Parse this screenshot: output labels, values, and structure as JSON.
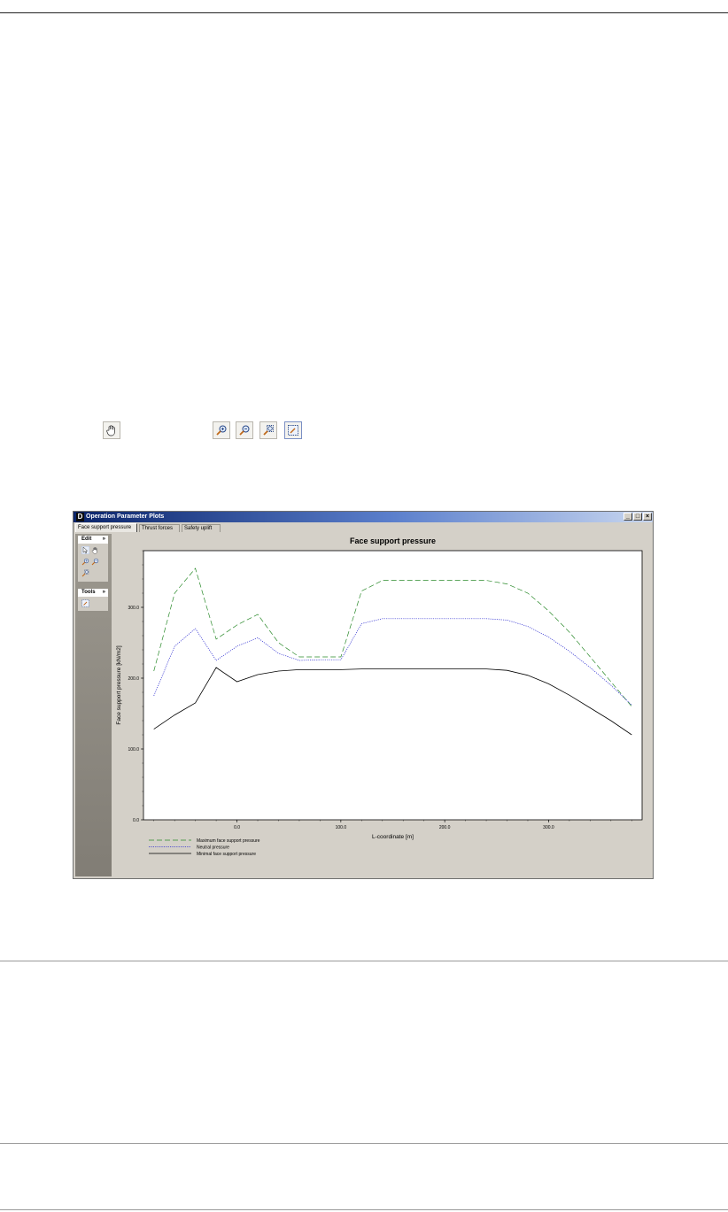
{
  "toolbar": {
    "icons": [
      "pan-hand-icon",
      "zoom-in-icon",
      "zoom-out-icon",
      "zoom-reset-icon",
      "zoom-window-icon"
    ]
  },
  "window": {
    "title": "Operation Parameter Plots",
    "logo": "D",
    "controls": {
      "minimize": "_",
      "maximize": "□",
      "close": "×"
    },
    "tabs": [
      {
        "label": "Face support pressure",
        "active": true
      },
      {
        "label": "Thrust forces",
        "active": false
      },
      {
        "label": "Safety uplift",
        "active": false
      }
    ],
    "sidebar": {
      "edit_label": "Edit",
      "tools_label": "Tools",
      "collapse_glyph": "»"
    }
  },
  "chart_data": {
    "type": "line",
    "title": "Face support pressure",
    "xlabel": "L-coordinate [m]",
    "ylabel": "Face support pressure [kN/m2]",
    "xlim": [
      -90,
      390
    ],
    "ylim": [
      0,
      380
    ],
    "x_ticks": [
      "0.0",
      "100.0",
      "200.0",
      "300.0"
    ],
    "y_ticks": [
      "0.0",
      "100.0",
      "200.0",
      "300.0"
    ],
    "grid": false,
    "legend_position": "bottom-left",
    "series": [
      {
        "name": "Maximum face support pressure",
        "style": "dashed",
        "color": "#2a8a2a",
        "x": [
          -80,
          -60,
          -40,
          -20,
          0,
          20,
          40,
          60,
          80,
          100,
          120,
          140,
          160,
          180,
          200,
          220,
          240,
          260,
          280,
          300,
          320,
          340,
          360,
          380
        ],
        "y": [
          210,
          320,
          355,
          255,
          275,
          290,
          250,
          230,
          230,
          230,
          323,
          338,
          338,
          338,
          338,
          338,
          338,
          333,
          320,
          295,
          265,
          230,
          195,
          160
        ]
      },
      {
        "name": "Neutral pressure",
        "style": "dotted",
        "color": "#2a2ad0",
        "x": [
          -80,
          -60,
          -40,
          -20,
          0,
          20,
          40,
          60,
          80,
          100,
          120,
          140,
          160,
          180,
          200,
          220,
          240,
          260,
          280,
          300,
          320,
          340,
          360,
          380
        ],
        "y": [
          175,
          245,
          270,
          225,
          245,
          257,
          235,
          225,
          226,
          226,
          277,
          284,
          284,
          284,
          284,
          284,
          284,
          282,
          273,
          258,
          238,
          215,
          190,
          162
        ]
      },
      {
        "name": "Minimal face support pressure",
        "style": "solid",
        "color": "#000000",
        "x": [
          -80,
          -60,
          -40,
          -20,
          -10,
          0,
          20,
          40,
          60,
          80,
          100,
          120,
          140,
          160,
          180,
          200,
          220,
          240,
          260,
          280,
          300,
          320,
          340,
          360,
          380
        ],
        "y": [
          128,
          148,
          165,
          215,
          205,
          195,
          205,
          210,
          212,
          212,
          212,
          213,
          213,
          213,
          213,
          213,
          213,
          213,
          211,
          204,
          192,
          176,
          158,
          140,
          120
        ]
      }
    ]
  }
}
